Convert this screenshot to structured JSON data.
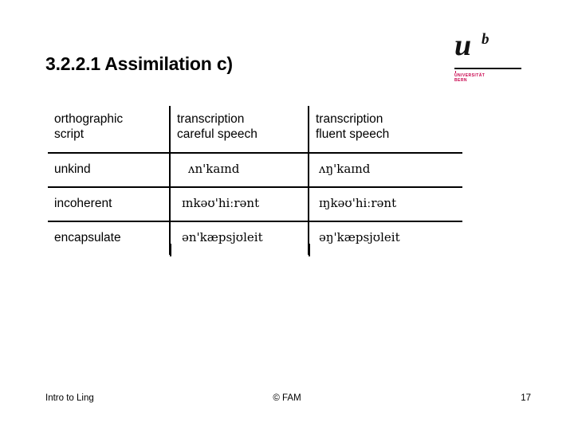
{
  "slide": {
    "title": "3.2.2.1 Assimilation c)",
    "page_number": "17"
  },
  "logo": {
    "mark": "u",
    "superscript": "b",
    "wordmark_line1": "UNIVERSITÄT",
    "wordmark_line2": "BERN",
    "accent_color": "#c8004b"
  },
  "table": {
    "headers": [
      {
        "line1": "orthographic",
        "line2": "script"
      },
      {
        "line1": "transcription",
        "line2": "careful speech"
      },
      {
        "line1": "transcription",
        "line2": "fluent speech"
      }
    ],
    "rows": [
      {
        "orthographic": "unkind",
        "careful": "ʌn'kaɪnd",
        "fluent": "ʌŋ'kaɪnd"
      },
      {
        "orthographic": "incoherent",
        "careful": "ɪnkəʊ'hiːrənt",
        "fluent": "ɪŋkəʊ'hiːrənt"
      },
      {
        "orthographic": "encapsulate",
        "careful": "ən'kæpsjʊleit",
        "fluent": "əŋ'kæpsjʊleit"
      }
    ]
  },
  "footer": {
    "left": "Intro to Ling",
    "center": "© FAM",
    "right": "17"
  }
}
